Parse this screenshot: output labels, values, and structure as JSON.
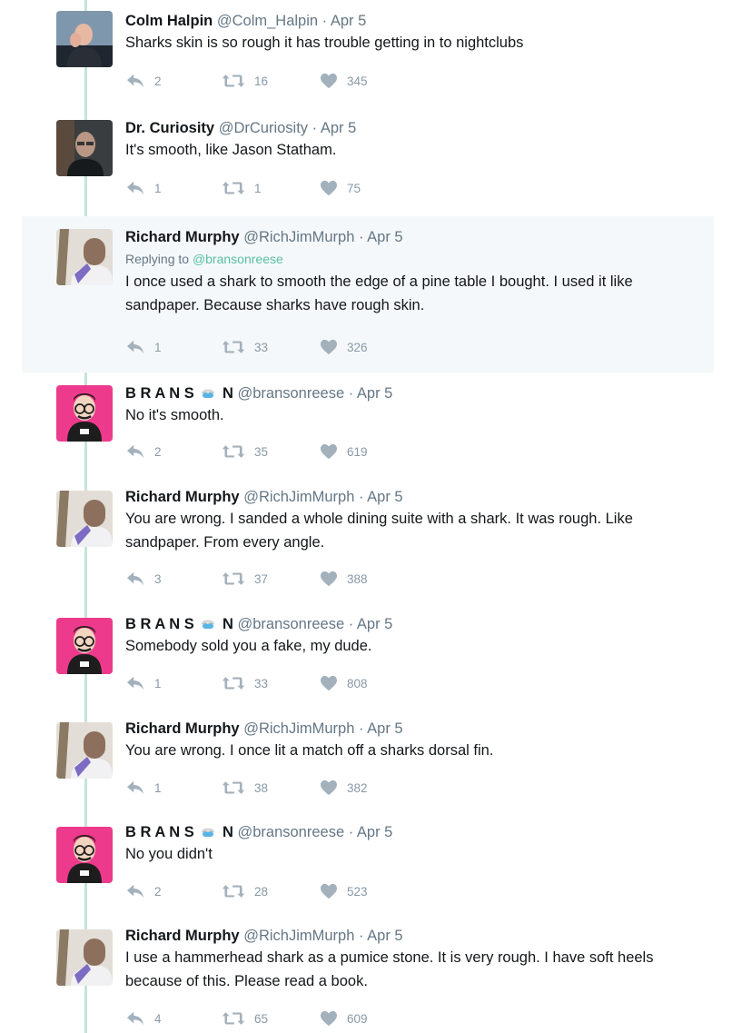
{
  "tweets": [
    {
      "name": "Colm Halpin",
      "handle": "@Colm_Halpin",
      "date": "Apr 5",
      "reply_to_label": "",
      "reply_to_user": "",
      "text": "Sharks skin is so rough it has trouble getting in to nightclubs",
      "replies": "2",
      "retweets": "16",
      "likes": "345"
    },
    {
      "name": "Dr. Curiosity",
      "handle": "@DrCuriosity",
      "date": "Apr 5",
      "reply_to_label": "",
      "reply_to_user": "",
      "text": "It's smooth, like Jason Statham.",
      "replies": "1",
      "retweets": "1",
      "likes": "75"
    },
    {
      "name": "Richard Murphy",
      "handle": "@RichJimMurph",
      "date": "Apr 5",
      "reply_to_label": "Replying to",
      "reply_to_user": "@bransonreese",
      "text": "I once used a shark to smooth the edge of a pine table I bought. I used it like sandpaper. Because sharks have rough skin.",
      "replies": "1",
      "retweets": "33",
      "likes": "326"
    },
    {
      "name_a": "B R A N S",
      "name_b": "N",
      "handle": "@bransonreese",
      "date": "Apr 5",
      "text": "No it's smooth.",
      "replies": "2",
      "retweets": "35",
      "likes": "619"
    },
    {
      "name": "Richard Murphy",
      "handle": "@RichJimMurph",
      "date": "Apr 5",
      "text": "You are wrong. I sanded a whole dining suite with a shark. It was rough. Like sandpaper. From every angle.",
      "replies": "3",
      "retweets": "37",
      "likes": "388"
    },
    {
      "name_a": "B R A N S",
      "name_b": "N",
      "handle": "@bransonreese",
      "date": "Apr 5",
      "text": "Somebody sold you a fake, my dude.",
      "replies": "1",
      "retweets": "33",
      "likes": "808"
    },
    {
      "name": "Richard Murphy",
      "handle": "@RichJimMurph",
      "date": "Apr 5",
      "text": "You are wrong. I once lit a match off a sharks dorsal fin.",
      "replies": "1",
      "retweets": "38",
      "likes": "382"
    },
    {
      "name_a": "B R A N S",
      "name_b": "N",
      "handle": "@bransonreese",
      "date": "Apr 5",
      "text": "No you didn't",
      "replies": "2",
      "retweets": "28",
      "likes": "523"
    },
    {
      "name": "Richard Murphy",
      "handle": "@RichJimMurph",
      "date": "Apr 5",
      "text": "I use a hammerhead shark as a pumice stone. It is very rough. I have soft heels because of this. Please read a book.",
      "replies": "4",
      "retweets": "65",
      "likes": "609"
    }
  ],
  "separator": "·",
  "icons": {
    "reply": "reply-icon",
    "retweet": "retweet-icon",
    "like": "heart-icon",
    "emoji": "diver-mask-emoji-icon"
  },
  "colors": {
    "thread_line": "#c5e5d6",
    "reply_link": "#59c1a0",
    "muted": "#657786",
    "highlight_bg": "#f5f8fa",
    "branson_avatar_bg": "#ee3a8c"
  }
}
